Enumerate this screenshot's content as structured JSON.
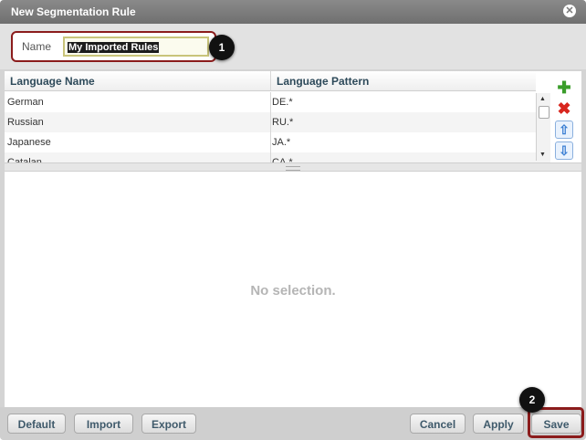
{
  "dialog": {
    "title": "New Segmentation Rule",
    "close_icon": "close-circle-icon"
  },
  "name_field": {
    "label": "Name",
    "value": "My Imported Rules"
  },
  "callouts": [
    "1",
    "2"
  ],
  "table": {
    "columns": [
      "Language Name",
      "Language Pattern"
    ],
    "rows": [
      {
        "language": "German",
        "pattern": "DE.*"
      },
      {
        "language": "Russian",
        "pattern": "RU.*"
      },
      {
        "language": "Japanese",
        "pattern": "JA.*"
      },
      {
        "language": "Catalan",
        "pattern": "CA.*"
      }
    ]
  },
  "toolbar_icons": [
    "add-icon",
    "remove-icon",
    "move-up-icon",
    "move-down-icon"
  ],
  "detail": {
    "empty_text": "No selection."
  },
  "buttons": {
    "default": "Default",
    "import": "Import",
    "export": "Export",
    "cancel": "Cancel",
    "apply": "Apply",
    "save": "Save"
  },
  "colors": {
    "callout_outline": "#8b1c1c",
    "add": "#3a9d2a",
    "remove": "#d8261e",
    "arrows": "#3b7fd3"
  }
}
